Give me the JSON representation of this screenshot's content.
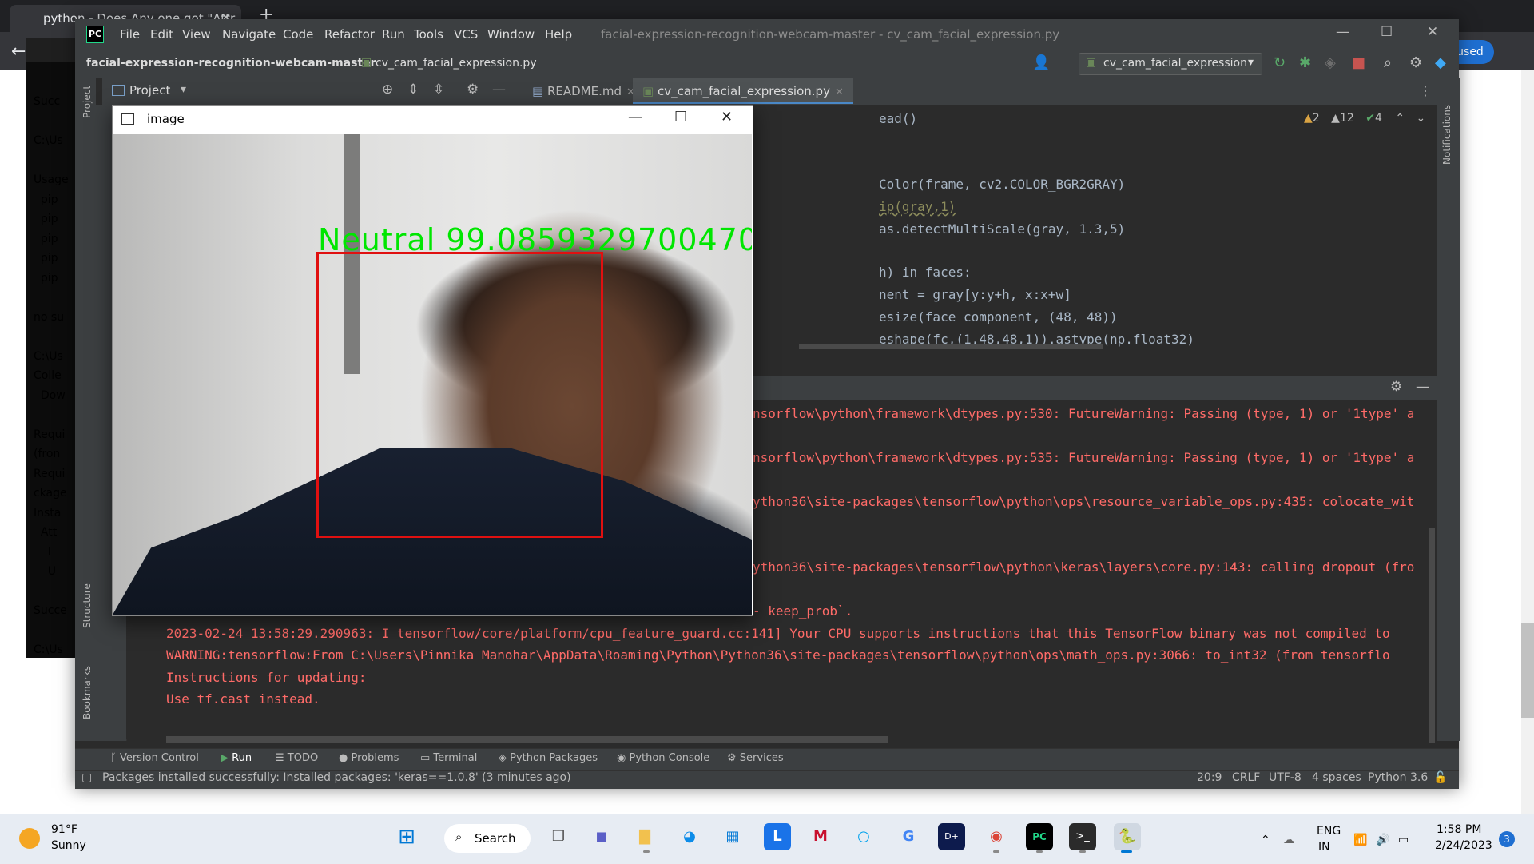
{
  "browser": {
    "tab_title": "python - Does Any one got \"Attr",
    "tab_close": "×",
    "new_tab": "+",
    "used_label": "used"
  },
  "terminal": {
    "lines": [
      "Succ",
      "",
      "C:\\Us",
      "",
      "Usage",
      "  pip",
      "  pip",
      "  pip",
      "  pip",
      "  pip",
      "",
      "no su",
      "",
      "C:\\Us",
      "Colle",
      "  Dow",
      "",
      "Requi",
      "(fron",
      "Requi",
      "ckage",
      "Insta",
      "  Att",
      "    I",
      "    U",
      "",
      "Succe",
      "",
      "C:\\Us"
    ]
  },
  "ide": {
    "logo": "PC",
    "menu": [
      "File",
      "Edit",
      "View",
      "Navigate",
      "Code",
      "Refactor",
      "Run",
      "Tools",
      "VCS",
      "Window",
      "Help"
    ],
    "window_title": "facial-expression-recognition-webcam-master - cv_cam_facial_expression.py",
    "project_name": "facial-expression-recognition-webcam-master",
    "file_name": "cv_cam_facial_expression.py",
    "run_config": "cv_cam_facial_expression",
    "project_tab": "Project",
    "tabs": [
      "README.md",
      "cv_cam_facial_expression.py"
    ],
    "left_labels": [
      "Project",
      "Structure",
      "Bookmarks"
    ],
    "right_labels": [
      "Notifications"
    ],
    "inspections": {
      "errors": "2",
      "warnings": "12",
      "ok": "4"
    },
    "code": [
      "ead()",
      "Color(frame, cv2.COLOR_BGR2GRAY)",
      "ip(gray,1)",
      "as.detectMultiScale(gray, 1.3,5)",
      "h) in faces:",
      "nent = gray[y:y+h, x:x+w]",
      "esize(face_component, (48, 48))",
      "eshape(fc,(1,48,48,1)).astype(np.float32)"
    ],
    "console": [
      "nsorflow\\python\\framework\\dtypes.py:530: FutureWarning: Passing (type, 1) or '1type' a",
      "nsorflow\\python\\framework\\dtypes.py:535: FutureWarning: Passing (type, 1) or '1type' a",
      "ython36\\site-packages\\tensorflow\\python\\ops\\resource_variable_ops.py:435: colocate_wit",
      "ython36\\site-packages\\tensorflow\\python\\keras\\layers\\core.py:143: calling dropout (fro",
      "- keep_prob`.",
      "2023-02-24 13:58:29.290963: I tensorflow/core/platform/cpu_feature_guard.cc:141] Your CPU supports instructions that this TensorFlow binary was not compiled to",
      "WARNING:tensorflow:From C:\\Users\\Pinnika Manohar\\AppData\\Roaming\\Python\\Python36\\site-packages\\tensorflow\\python\\ops\\math_ops.py:3066: to_int32 (from tensorflo",
      "Instructions for updating:",
      "Use tf.cast instead."
    ],
    "tool_windows": [
      "Version Control",
      "Run",
      "TODO",
      "Problems",
      "Terminal",
      "Python Packages",
      "Python Console",
      "Services"
    ],
    "status_message": "Packages installed successfully: Installed packages: 'keras==1.0.8' (3 minutes ago)",
    "status": {
      "position": "20:9",
      "line_sep": "CRLF",
      "encoding": "UTF-8",
      "indent": "4 spaces",
      "interpreter": "Python 3.6"
    }
  },
  "cv_window": {
    "title": "image",
    "emotion_label": "Neutral  99.0859329700470"
  },
  "taskbar": {
    "weather_temp": "91°F",
    "weather_desc": "Sunny",
    "search_label": "Search",
    "lang_top": "ENG",
    "lang_bottom": "IN",
    "time": "1:58 PM",
    "date": "2/24/2023",
    "notifications": "3"
  }
}
